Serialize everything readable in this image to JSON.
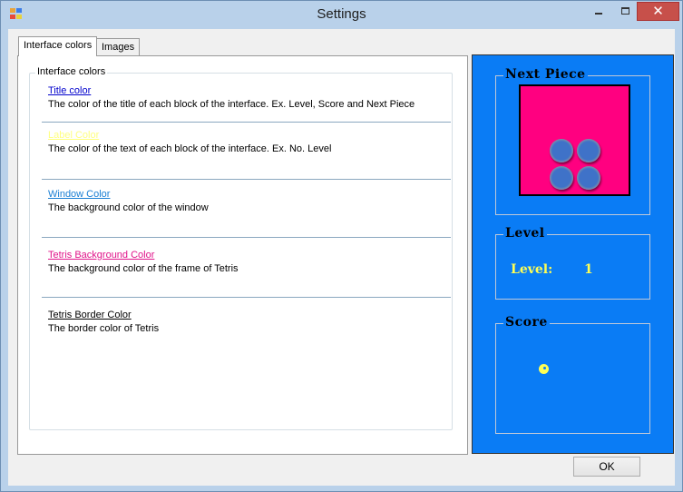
{
  "window": {
    "title": "Settings",
    "app_icon": "app-window-icon",
    "controls": {
      "minimize": "minimize-icon",
      "maximize": "maximize-icon",
      "close_glyph": "✕"
    }
  },
  "tabs": [
    {
      "label": "Interface colors",
      "active": true
    },
    {
      "label": "Images",
      "active": false
    }
  ],
  "group": {
    "legend": "Interface colors",
    "items": [
      {
        "label": "Title color",
        "description": "The color of the title of each block of the interface. Ex. Level, Score and Next Piece",
        "color": "#0000cc"
      },
      {
        "label": "Label Color",
        "description": "The color of the text of each block of the interface. Ex. No. Level",
        "color": "#ffff80"
      },
      {
        "label": "Window Color",
        "description": "The background color of the window",
        "color": "#0a7cf5"
      },
      {
        "label": "Tetris Background Color",
        "description": "The background color of the frame of Tetris",
        "color": "#ff0080"
      },
      {
        "label": "Tetris Border Color",
        "description": "The border color of Tetris",
        "color": "#000000"
      }
    ]
  },
  "preview": {
    "next_piece": {
      "title": "Next Piece",
      "background": "#ff0080",
      "border": "#000000"
    },
    "level": {
      "title": "Level",
      "label": "Level:",
      "value": "1"
    },
    "score": {
      "title": "Score",
      "value": "0"
    },
    "window_color": "#0a7cf5",
    "label_color": "#ffff55"
  },
  "buttons": {
    "ok": "OK"
  }
}
